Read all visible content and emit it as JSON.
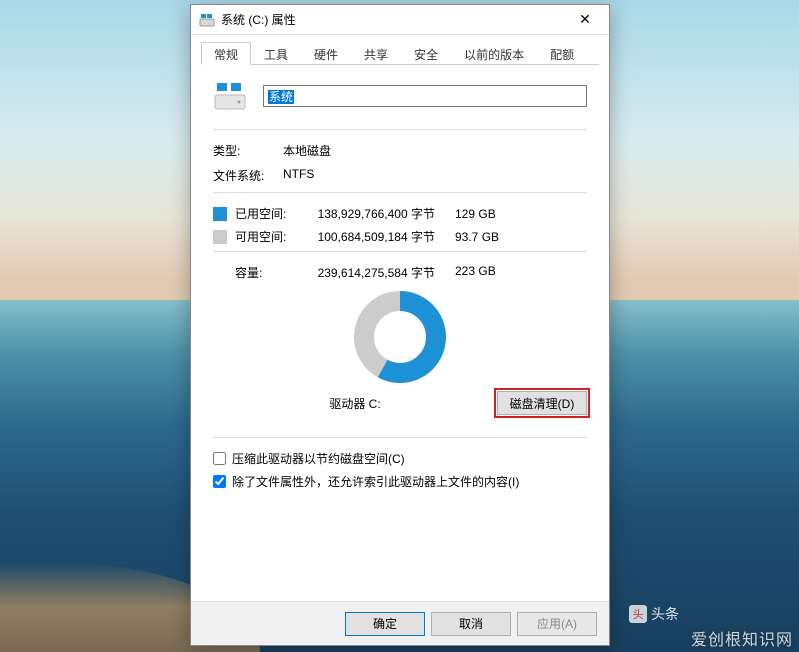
{
  "window": {
    "title": "系统 (C:) 属性",
    "close_label": "✕"
  },
  "tabs": {
    "general": "常规",
    "tools": "工具",
    "hardware": "硬件",
    "sharing": "共享",
    "security": "安全",
    "previous": "以前的版本",
    "quota": "配额"
  },
  "drive": {
    "name": "系统",
    "type_label": "类型:",
    "type_value": "本地磁盘",
    "filesystem_label": "文件系统:",
    "filesystem_value": "NTFS",
    "used_label": "已用空间:",
    "used_bytes": "138,929,766,400 字节",
    "used_gb": "129 GB",
    "free_label": "可用空间:",
    "free_bytes": "100,684,509,184 字节",
    "free_gb": "93.7 GB",
    "capacity_label": "容量:",
    "capacity_bytes": "239,614,275,584 字节",
    "capacity_gb": "223 GB",
    "drive_label": "驱动器 C:",
    "cleanup_button": "磁盘清理(D)",
    "compress_checkbox": "压缩此驱动器以节约磁盘空间(C)",
    "index_checkbox": "除了文件属性外，还允许索引此驱动器上文件的内容(I)"
  },
  "buttons": {
    "ok": "确定",
    "cancel": "取消",
    "apply": "应用(A)"
  },
  "chart_data": {
    "type": "pie",
    "title": "驱动器 C:",
    "series": [
      {
        "name": "已用空间",
        "value": 129,
        "color": "#1e90d6"
      },
      {
        "name": "可用空间",
        "value": 93.7,
        "color": "#cccccc"
      }
    ],
    "unit": "GB",
    "total": 223
  },
  "watermark": "爱创根知识网",
  "toutiao": "头条"
}
